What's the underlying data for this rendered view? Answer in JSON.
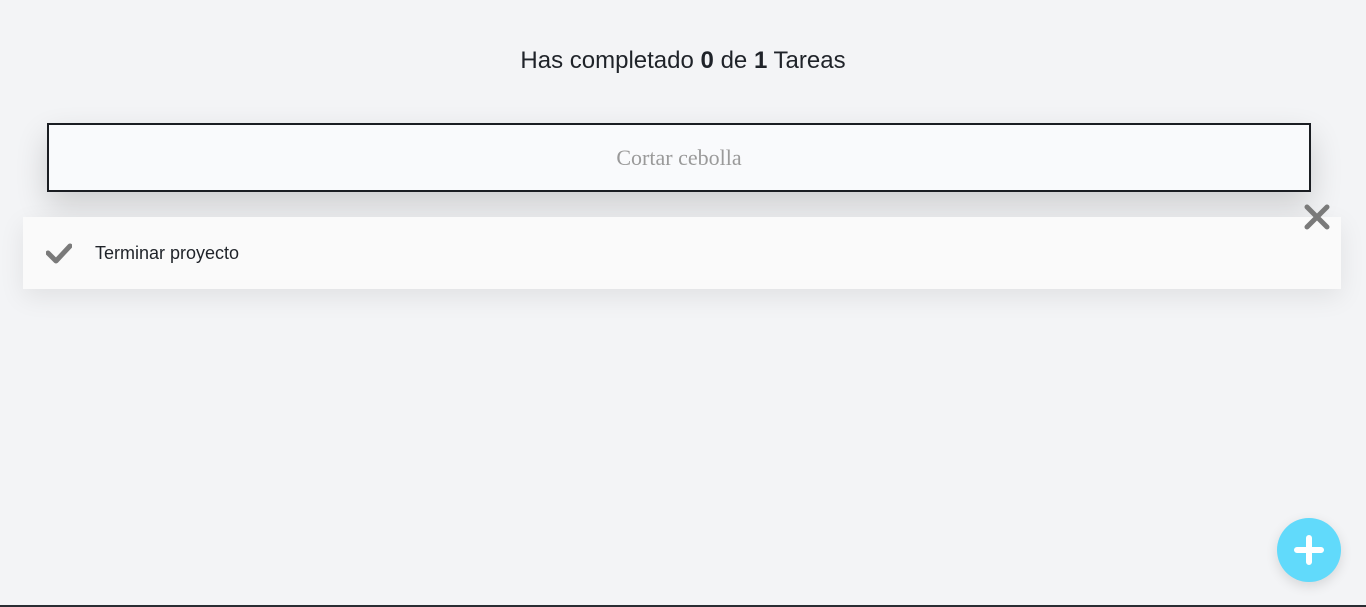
{
  "counter": {
    "prefix": "Has completado",
    "completed": "0",
    "middle": "de",
    "total": "1",
    "suffix": "Tareas"
  },
  "input": {
    "placeholder": "Cortar cebolla",
    "value": ""
  },
  "todos": [
    {
      "text": "Terminar proyecto",
      "completed": false
    }
  ],
  "icons": {
    "check": "check-icon",
    "delete": "close-icon",
    "add": "plus-icon"
  },
  "colors": {
    "background": "#f3f4f6",
    "accent": "#61dafb",
    "icon": "#7a7a7a",
    "text": "#1f2329"
  }
}
